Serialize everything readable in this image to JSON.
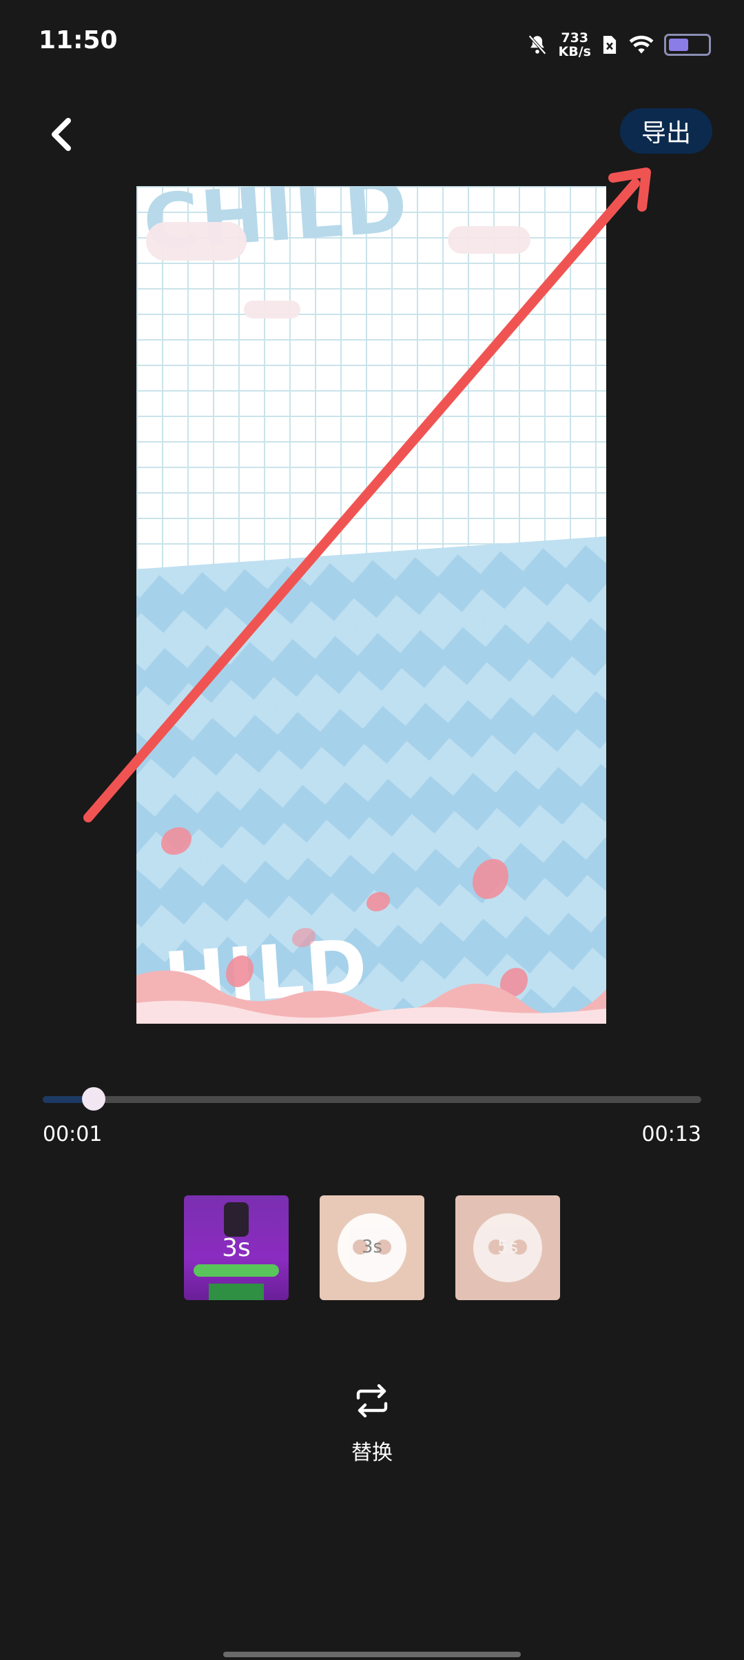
{
  "status": {
    "time": "11:50",
    "net_speed_value": "733",
    "net_speed_unit": "KB/s"
  },
  "header": {
    "export_label": "导出"
  },
  "preview": {
    "top_text": "CHILD",
    "bottom_text": "HILD"
  },
  "player": {
    "current_time": "00:01",
    "total_time": "00:13",
    "progress": 0.077
  },
  "thumbnails": [
    {
      "overlay": "3s"
    },
    {
      "overlay": "3s"
    },
    {
      "overlay": "5s"
    }
  ],
  "actions": {
    "replace_label": "替换"
  },
  "colors": {
    "export_bg": "#0b2a4e",
    "annotation_arrow": "#f05452",
    "progress_fill": "#1d3a64"
  }
}
